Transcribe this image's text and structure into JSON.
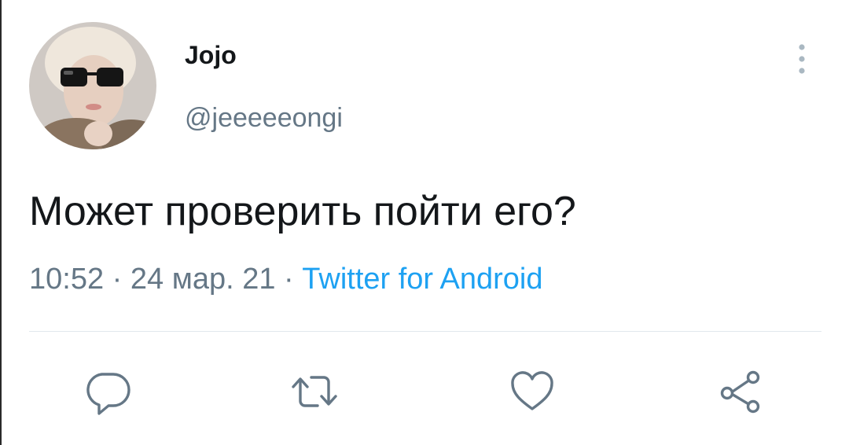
{
  "tweet": {
    "author": {
      "display_name": "Jojo",
      "handle": "@jeeeeeongi"
    },
    "text": "Может проверить пойти его?",
    "time": "10:52",
    "date": "24 мар. 21",
    "separator": "·",
    "source": "Twitter for Android"
  },
  "actions": [
    {
      "id": "reply",
      "icon": "reply-icon"
    },
    {
      "id": "retweet",
      "icon": "retweet-icon"
    },
    {
      "id": "like",
      "icon": "heart-icon"
    },
    {
      "id": "share",
      "icon": "share-icon"
    }
  ],
  "colors": {
    "text": "#14171a",
    "secondary": "#657786",
    "link": "#1da1f2",
    "divider": "#e1e8ed",
    "icon": "#657786"
  }
}
